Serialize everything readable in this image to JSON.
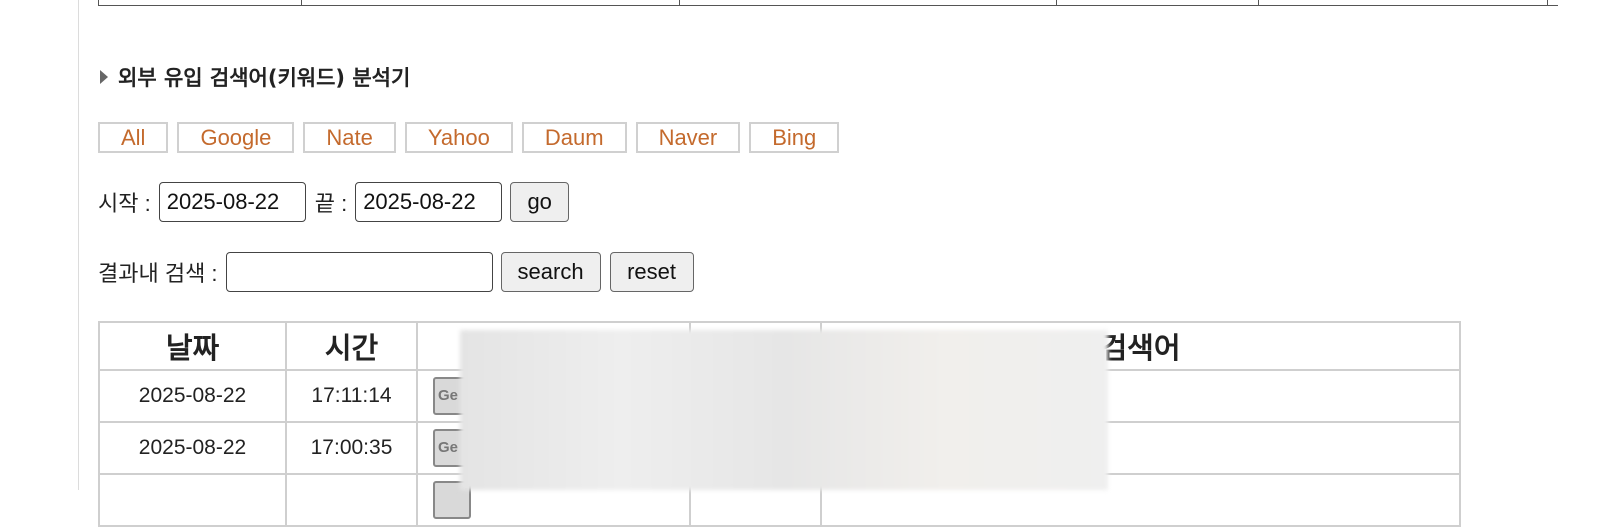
{
  "section": {
    "title": "외부 유입 검색어(키워드) 분석기"
  },
  "engines": [
    "All",
    "Google",
    "Nate",
    "Yahoo",
    "Daum",
    "Naver",
    "Bing"
  ],
  "date_filter": {
    "start_label": "시작 :",
    "start_value": "2025-08-22",
    "end_label": "끝 :",
    "end_value": "2025-08-22",
    "go_label": "go"
  },
  "result_search": {
    "label": "결과내 검색 :",
    "value": "",
    "search_label": "search",
    "reset_label": "reset"
  },
  "table": {
    "headers": [
      "날짜",
      "시간",
      "",
      "",
      "검색어"
    ],
    "rows": [
      {
        "date": "2025-08-22",
        "time": "17:11:14"
      },
      {
        "date": "2025-08-22",
        "time": "17:00:35"
      }
    ]
  }
}
